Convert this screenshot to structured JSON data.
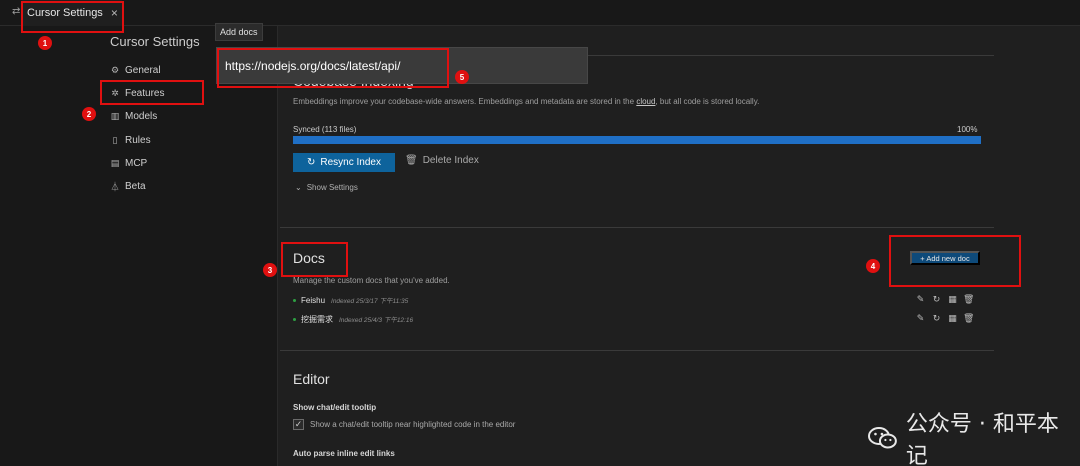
{
  "tabbar": {
    "toggle_icon": "split-arrows-icon",
    "tab_title": "Cursor Settings",
    "close_glyph": "×"
  },
  "sidebar": {
    "title": "Cursor Settings",
    "items": [
      {
        "label": "General",
        "icon": "gear-icon"
      },
      {
        "label": "Features",
        "icon": "sparkle-icon"
      },
      {
        "label": "Models",
        "icon": "chart-icon"
      },
      {
        "label": "Rules",
        "icon": "document-icon"
      },
      {
        "label": "MCP",
        "icon": "server-icon"
      },
      {
        "label": "Beta",
        "icon": "flask-icon"
      }
    ]
  },
  "popup": {
    "tooltip": "Add docs",
    "url_value": "https://nodejs.org/docs/latest/api/"
  },
  "indexing": {
    "title_obscured": "Codebase Indexing",
    "description": "Embeddings improve your codebase-wide answers. Embeddings and metadata are stored in the ",
    "description_link": "cloud",
    "description_tail": ", but all code is stored locally.",
    "synced_label": "Synced (113 files)",
    "percent_text": "100%",
    "progress_fraction": 1.0,
    "resync_label": "Resync Index",
    "delete_label": "Delete Index",
    "show_settings_label": "Show Settings"
  },
  "docs": {
    "title": "Docs",
    "description": "Manage the custom docs that you've added.",
    "add_label": "+ Add new doc",
    "items": [
      {
        "name": "Feishu",
        "meta": "Indexed 25/3/17 下午11:35"
      },
      {
        "name": "挖掘需求",
        "meta": "Indexed 25/4/3 下午12:16"
      }
    ]
  },
  "editor": {
    "title": "Editor",
    "setting1_label": "Show chat/edit tooltip",
    "setting1_checkbox_text": "Show a chat/edit tooltip near highlighted code in the editor",
    "setting1_checked": true,
    "setting2_label": "Auto parse inline edit links"
  },
  "annotations": [
    "1",
    "2",
    "3",
    "4",
    "5"
  ],
  "watermark": {
    "text": "公众号 · 和平本记",
    "icon": "wechat-icon"
  },
  "colors": {
    "accent_blue": "#0e639c",
    "progress_blue": "#1f6fc5",
    "annotation_red": "#e01010",
    "synced_dot_green": "#2ea043"
  }
}
